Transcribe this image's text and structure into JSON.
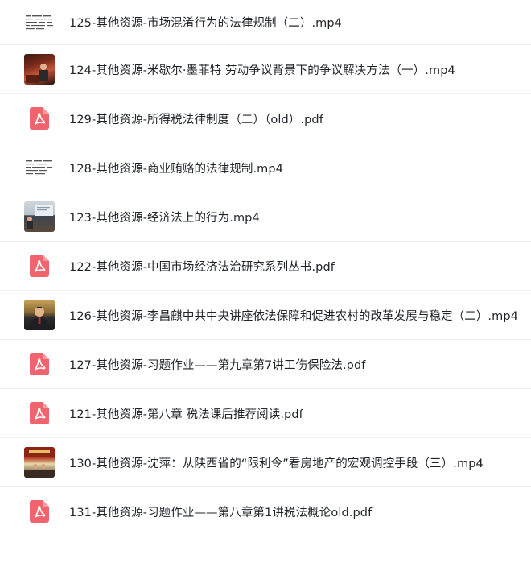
{
  "files": [
    {
      "name": "125-其他资源-市场混淆行为的法律规制（二）.mp4",
      "thumb": "doc-scan"
    },
    {
      "name": "124-其他资源-米歇尔·墨菲特 劳动争议背景下的争议解决方法（一）.mp4",
      "thumb": "photo-red"
    },
    {
      "name": "129-其他资源-所得税法律制度（二）（old）.pdf",
      "thumb": "pdf-icon"
    },
    {
      "name": "128-其他资源-商业贿赂的法律规制.mp4",
      "thumb": "doc-scan"
    },
    {
      "name": "123-其他资源-经济法上的行为.mp4",
      "thumb": "photo-lecture"
    },
    {
      "name": "122-其他资源-中国市场经济法治研究系列丛书.pdf",
      "thumb": "pdf-icon"
    },
    {
      "name": "126-其他资源-李昌麒中共中央讲座依法保障和促进农村的改革发展与稳定（二）.mp4",
      "thumb": "photo-man"
    },
    {
      "name": "127-其他资源-习题作业——第九章第7讲工伤保险法.pdf",
      "thumb": "pdf-icon"
    },
    {
      "name": "121-其他资源-第八章 税法课后推荐阅读.pdf",
      "thumb": "pdf-icon"
    },
    {
      "name": "130-其他资源-沈萍：从陕西省的“限利令”看房地产的宏观调控手段（三）.mp4",
      "thumb": "photo-hall"
    },
    {
      "name": "131-其他资源-习题作业——第八章第1讲税法概论old.pdf",
      "thumb": "pdf-icon"
    }
  ],
  "colors": {
    "pdf": "#f0656d",
    "text": "#1f2329",
    "divider": "#eeeeee"
  }
}
